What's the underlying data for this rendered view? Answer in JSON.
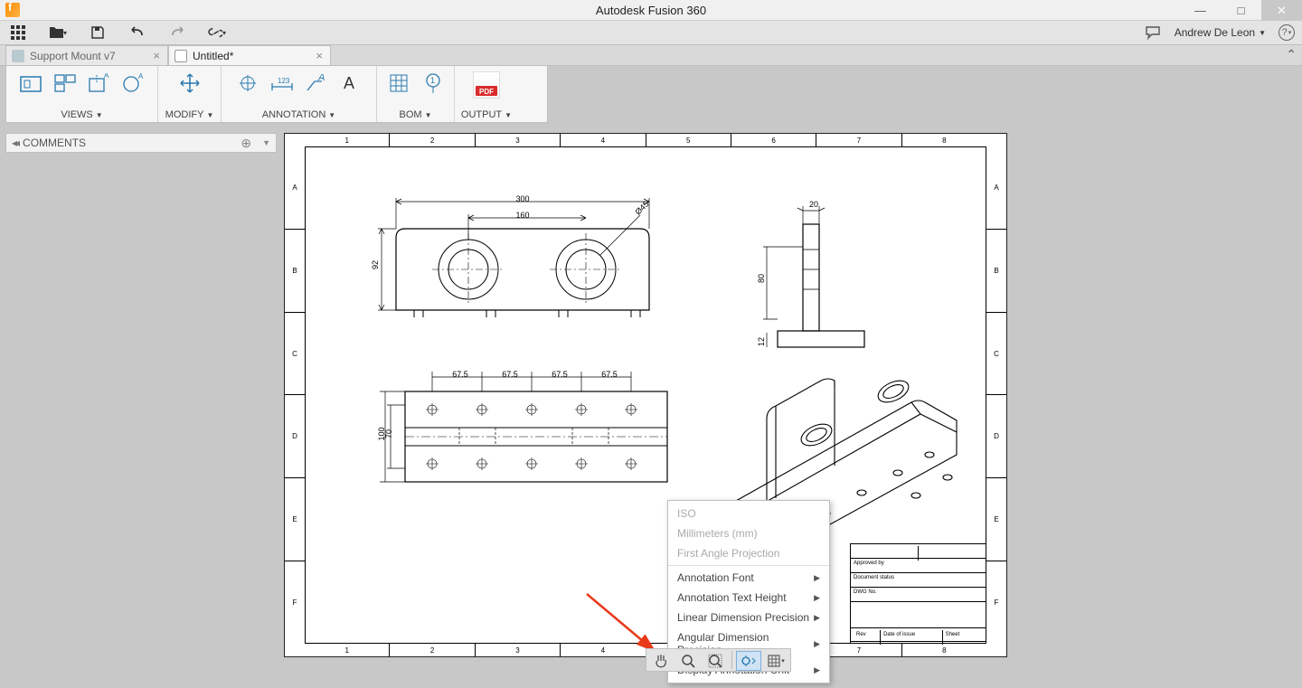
{
  "app": {
    "title": "Autodesk Fusion 360"
  },
  "user": {
    "name": "Andrew De Leon"
  },
  "tabs": [
    {
      "label": "Support Mount v7",
      "active": false
    },
    {
      "label": "Untitled*",
      "active": true
    }
  ],
  "ribbon": {
    "views": "VIEWS",
    "modify": "MODIFY",
    "annotation": "ANNOTATION",
    "bom": "BOM",
    "output": "OUTPUT",
    "pdf": "PDF"
  },
  "comments": {
    "label": "COMMENTS"
  },
  "sheet": {
    "cols": [
      "1",
      "2",
      "3",
      "4",
      "5",
      "6",
      "7",
      "8"
    ],
    "rows": [
      "A",
      "B",
      "C",
      "D",
      "E",
      "F"
    ]
  },
  "dims": {
    "d300": "300",
    "d160": "160",
    "d92": "92",
    "d45": "Ø45",
    "d80": "80",
    "d20": "20",
    "d12": "12",
    "d675a": "67.5",
    "d675b": "67.5",
    "d675c": "67.5",
    "d675d": "67.5",
    "d100": "100",
    "d70": "70"
  },
  "titleblock": {
    "approvedby": "Approved by",
    "docstatus": "Document status",
    "dwgno": "DWG No.",
    "rev": "Rev",
    "date": "Date of issue",
    "sheet": "Sheet"
  },
  "ctxmenu": {
    "iso": "ISO",
    "units": "Millimeters (mm)",
    "proj": "First Angle Projection",
    "annfont": "Annotation Font",
    "annheight": "Annotation Text Height",
    "linprec": "Linear Dimension Precision",
    "angprec": "Angular Dimension Precision",
    "dispunit": "Display Annotation Unit"
  }
}
